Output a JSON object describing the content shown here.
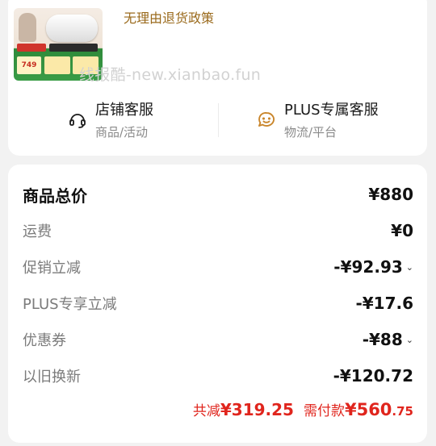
{
  "product": {
    "policy_text": "无理由退货政策",
    "thumb_price": "749"
  },
  "watermark": "线报酷-new.xianbao.fun",
  "services": [
    {
      "title": "店铺客服",
      "sub": "商品/活动",
      "icon": "headset-icon"
    },
    {
      "title": "PLUS专属客服",
      "sub": "物流/平台",
      "icon": "smile-chat-icon"
    }
  ],
  "fees": {
    "total": {
      "label": "商品总价",
      "value": "¥880"
    },
    "rows": [
      {
        "label": "运费",
        "value": "¥0",
        "chevron": false
      },
      {
        "label": "促销立减",
        "value": "-¥92.93",
        "chevron": true
      },
      {
        "label": "PLUS专享立减",
        "value": "-¥17.6",
        "chevron": false
      },
      {
        "label": "优惠券",
        "value": "-¥88",
        "chevron": true
      },
      {
        "label": "以旧换新",
        "value": "-¥120.72",
        "chevron": false
      }
    ]
  },
  "summary": {
    "discount_label": "共减",
    "discount_value": "¥319.25",
    "pay_label": "需付款",
    "pay_int": "¥560",
    "pay_dec": ".75"
  },
  "colors": {
    "accent_red": "#e0251d",
    "policy_gold": "#9a6a1c",
    "icon_orange": "#c9852a"
  }
}
